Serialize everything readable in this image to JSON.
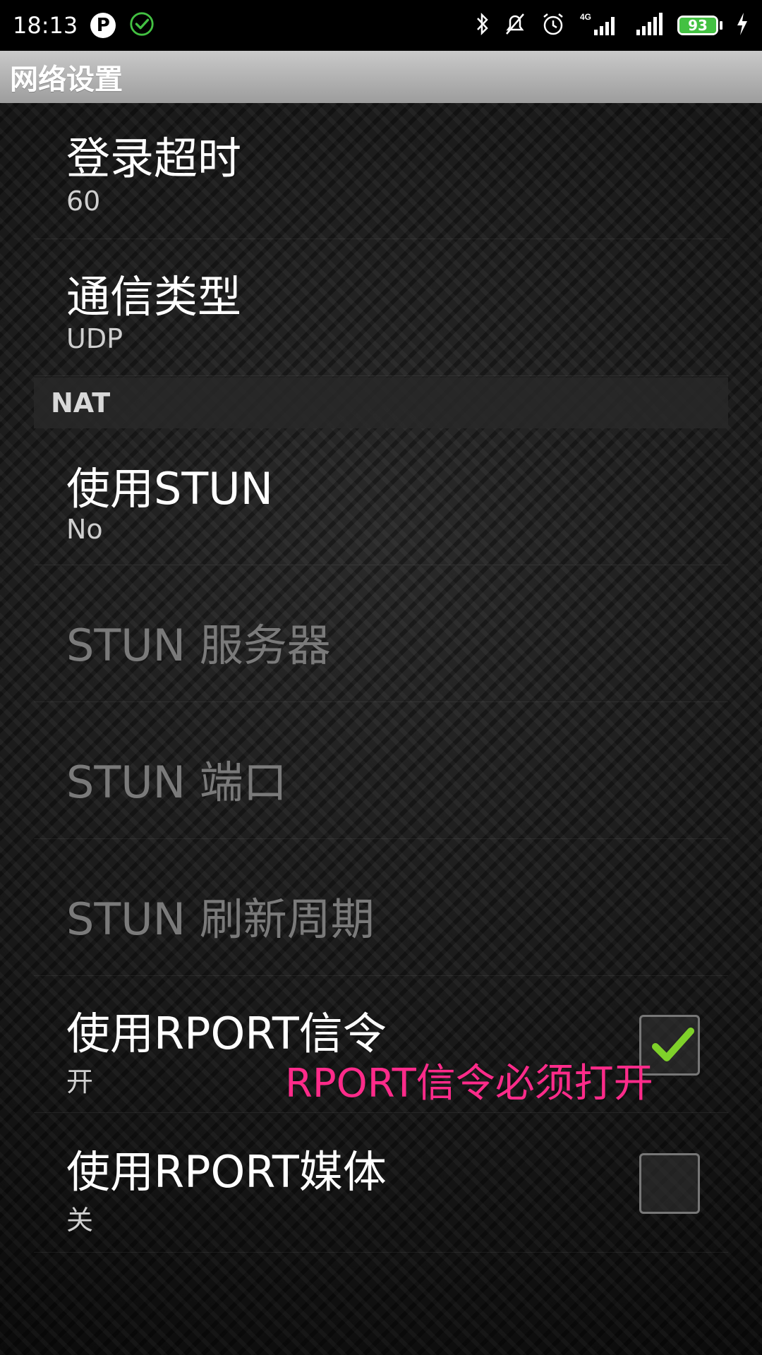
{
  "status_bar": {
    "time": "18:13",
    "battery_level": "93",
    "network": "4G"
  },
  "title_bar": {
    "title": "网络设置"
  },
  "preferences": {
    "login_timeout": {
      "label": "登录超时",
      "summary": "60"
    },
    "transport_type": {
      "label": "通信类型",
      "summary": "UDP"
    },
    "nat_header": "NAT",
    "use_stun": {
      "label": "使用STUN",
      "summary": "No"
    },
    "stun_server": {
      "label": "STUN 服务器"
    },
    "stun_port": {
      "label": "STUN 端口"
    },
    "stun_refresh": {
      "label": "STUN 刷新周期"
    },
    "rport_signal": {
      "label": "使用RPORT信令",
      "summary": "开",
      "checked": true
    },
    "rport_media": {
      "label": "使用RPORT媒体",
      "summary": "关",
      "checked": false
    }
  },
  "annotation": {
    "text": "RPORT信令必须打开",
    "color": "#ff2b8a"
  },
  "colors": {
    "check_green": "#7fd12a",
    "battery_green": "#43c142"
  }
}
